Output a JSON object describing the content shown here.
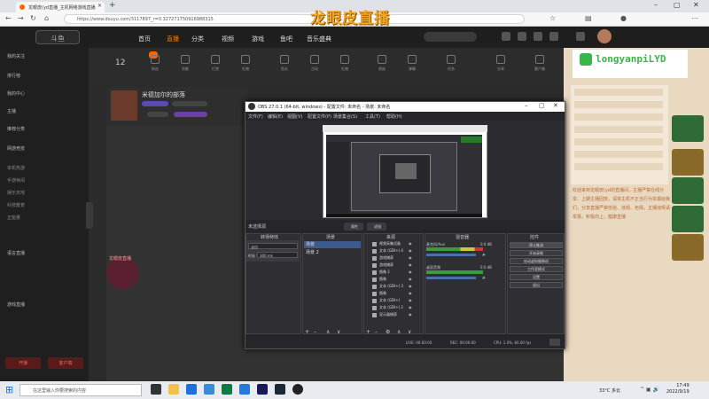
{
  "browser": {
    "tab_title": "龙眼皮(yd直播_主机网络游戏直播",
    "url": "https://www.douyu.com/3117897_r=0.327271750916988315",
    "watermark": "龙眼皮直播",
    "watermark_sub": "LONGYANPI"
  },
  "site": {
    "logo": "斗鱼",
    "nav": [
      "首页",
      "直播",
      "分类",
      "视频",
      "游戏",
      "鱼吧",
      "音乐盛典"
    ],
    "user_icons": [
      "关注",
      "历史",
      "下载",
      "开播",
      "充值"
    ],
    "categories": [
      "12",
      "等级",
      "粉丝",
      "贡献",
      "打赏",
      "礼物",
      "鱼丸",
      "活动",
      "礼物",
      "贵族",
      "弹幕",
      "任务",
      "分享",
      "客户端"
    ],
    "cat_count": "12"
  },
  "sidebar": {
    "items": [
      "我的关注",
      "排行榜",
      "我的中心",
      "主播",
      "推荐分类",
      "网游竞技",
      "单机热游",
      "手游休闲",
      "娱乐天地",
      "科技教育",
      "正能量",
      "语言直播",
      "游戏直播"
    ],
    "btn1": "开播",
    "btn2": "客户端"
  },
  "room": {
    "title": "米德加尔的部落",
    "player_label": "龙眼皮直播"
  },
  "ad": {
    "text": "longyanpiLYD"
  },
  "notice": "欢迎来到龙眼皮(yd的直播间，主播严禁在线分享、上期主播回放，请将主机不正当行为举报给我们，分享直播严禁低俗、违规、色情，主播违规请举报，积极向上，健康直播",
  "obs": {
    "title": "OBS 27.0.1 (64-bit, windows) - 配置文件: 未命名 - 场景: 未命名",
    "menu": [
      "文件(F)",
      "编辑(E)",
      "视图(V)",
      "配置文件(P)",
      "场景集合(S)",
      "工具(T)",
      "帮助(H)"
    ],
    "scenebar_label": "未选择源",
    "btn_props": "属性",
    "btn_filter": "滤镜",
    "dock_titles": [
      "转场特效",
      "场景",
      "来源",
      "混音器",
      "控件"
    ],
    "transition": {
      "label": "淡出",
      "duration_label": "时长",
      "duration": "300 ms"
    },
    "scenes": [
      "场景",
      "场景 2"
    ],
    "sources": [
      "视频采集设备",
      "文本 (GDI+) 4",
      "游戏捕获",
      "游戏捕获",
      "图像 2",
      "图像",
      "文本 (GDI+) 3",
      "图像",
      "文本 (GDI+)",
      "文本 (GDI+) 2",
      "显示器捕获"
    ],
    "mixer": [
      {
        "name": "麦克风/Aux",
        "value": "0.0 dB"
      },
      {
        "name": "桌面音频",
        "value": "0.0 dB"
      }
    ],
    "controls": [
      "停止推流",
      "开始录制",
      "启动虚拟摄像机",
      "工作室模式",
      "设置",
      "退出"
    ],
    "status": {
      "live": "LIVE: 00:00:00",
      "rec": "REC: 00:00:00",
      "cpu": "CPU: 1.0%, 60.00 fps"
    }
  },
  "taskbar": {
    "search": "在这里输入你要搜索的内容",
    "weather": "33°C 多云",
    "time": "17:49",
    "date": "2022/9/19"
  }
}
